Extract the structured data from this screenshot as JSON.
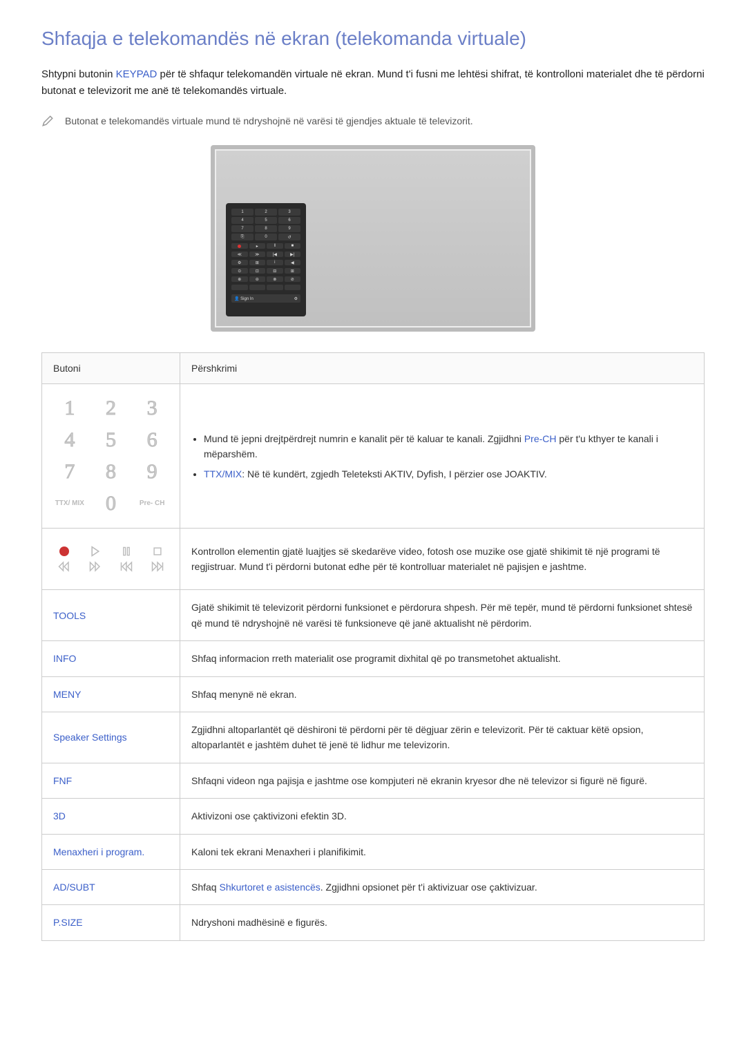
{
  "title": "Shfaqja e telekomandës në ekran (telekomanda virtuale)",
  "intro": {
    "part1": "Shtypni butonin ",
    "keypad": "KEYPAD",
    "part2": " për të shfaqur telekomandën virtuale në ekran. Mund t'i fusni me lehtësi shifrat, të kontrolloni materialet dhe të përdorni butonat e televizorit me anë të telekomandës virtuale."
  },
  "note": "Butonat e telekomandës virtuale mund të ndryshojnë në varësi të gjendjes aktuale të televizorit.",
  "table": {
    "headers": {
      "button": "Butoni",
      "desc": "Përshkrimi"
    },
    "keypad": {
      "li1_a": "Mund të jepni drejtpërdrejt numrin e kanalit për të kaluar te kanali. Zgjidhni ",
      "li1_pre": "Pre-CH",
      "li1_b": " për t'u kthyer te kanali i mëparshëm.",
      "li2_ttx": "TTX/MIX",
      "li2": ": Në të kundërt, zgjedh Teleteksti AKTIV, Dyfish, I përzier ose JOAKTIV."
    },
    "playback_desc": "Kontrollon elementin gjatë luajtjes së skedarëve video, fotosh ose muzike ose gjatë shikimit të një programi të regjistruar. Mund t'i përdorni butonat edhe për të kontrolluar materialet në pajisjen e jashtme.",
    "rows": {
      "tools": {
        "label": "TOOLS",
        "desc": "Gjatë shikimit të televizorit përdorni funksionet e përdorura shpesh. Për më tepër, mund të përdorni funksionet shtesë që mund të ndryshojnë në varësi të funksioneve që janë aktualisht në përdorim."
      },
      "info": {
        "label": "INFO",
        "desc": "Shfaq informacion rreth materialit ose programit dixhital që po transmetohet aktualisht."
      },
      "meny": {
        "label": "MENY",
        "desc": "Shfaq menynë në ekran."
      },
      "speaker": {
        "label": "Speaker Settings",
        "desc": "Zgjidhni altoparlantët që dëshironi të përdorni për të dëgjuar zërin e televizorit. Për të caktuar këtë opsion, altoparlantët e jashtëm duhet të jenë të lidhur me televizorin."
      },
      "fnf": {
        "label": "FNF",
        "desc": "Shfaqni videon nga pajisja e jashtme ose kompjuteri në ekranin kryesor dhe në televizor si figurë në figurë."
      },
      "3d": {
        "label": "3D",
        "desc": "Aktivizoni ose çaktivizoni efektin 3D."
      },
      "menaxheri": {
        "label": "Menaxheri i program.",
        "desc": "Kaloni tek ekrani Menaxheri i planifikimit."
      },
      "adsubt": {
        "label": "AD/SUBT",
        "desc_a": "Shfaq ",
        "link": "Shkurtoret e asistencës",
        "desc_b": ". Zgjidhni opsionet për t'i aktivizuar ose çaktivizuar."
      },
      "psize": {
        "label": "P.SIZE",
        "desc": "Ndryshoni madhësinë e figurës."
      }
    }
  },
  "keypad_keys": [
    "1",
    "2",
    "3",
    "4",
    "5",
    "6",
    "7",
    "8",
    "9",
    "TTX/\nMIX",
    "0",
    "Pre-\nCH"
  ],
  "remote_login": "Sign In"
}
